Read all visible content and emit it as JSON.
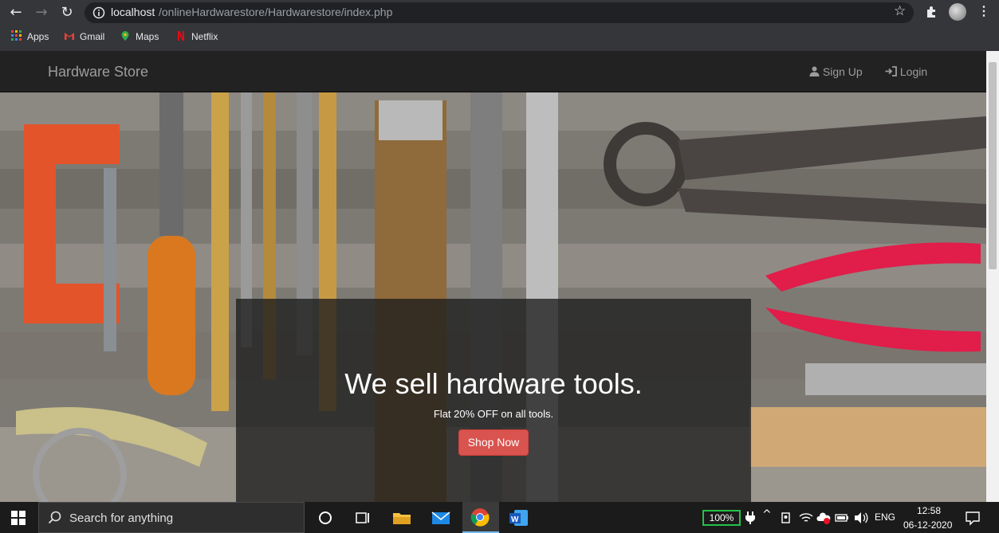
{
  "browser": {
    "url_host": "localhost",
    "url_path": "/onlineHardwarestore/Hardwarestore/index.php",
    "bookmarks": [
      "Apps",
      "Gmail",
      "Maps",
      "Netflix"
    ]
  },
  "navbar": {
    "brand": "Hardware Store",
    "signup_label": "Sign Up",
    "login_label": "Login"
  },
  "hero": {
    "headline": "We sell hardware tools.",
    "subline": "Flat 20% OFF on all tools.",
    "cta_label": "Shop Now"
  },
  "taskbar": {
    "search_placeholder": "Search for anything",
    "battery": "100%",
    "language": "ENG",
    "time": "12:58",
    "date": "06-12-2020"
  },
  "colors": {
    "navbar_bg": "#222222",
    "cta_bg": "#d9534f",
    "battery_outline": "#24c14a"
  }
}
